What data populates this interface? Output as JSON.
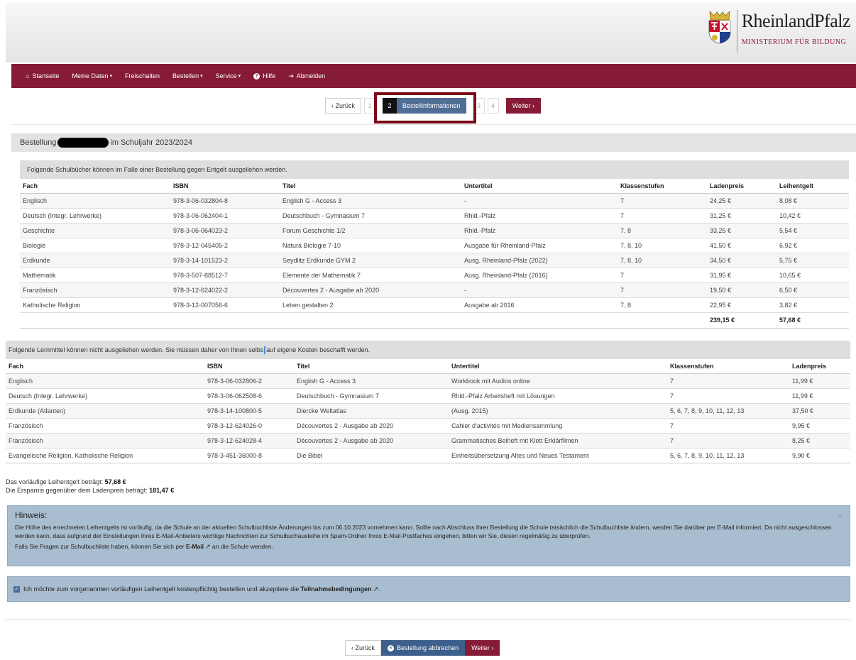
{
  "brand": {
    "name": "RheinlandPfalz",
    "subtitle": "MINISTERIUM FÜR BILDUNG"
  },
  "nav": [
    {
      "label": "Startseite",
      "icon": "home-icon"
    },
    {
      "label": "Meine Daten",
      "icon": "",
      "caret": true
    },
    {
      "label": "Freischalten",
      "icon": ""
    },
    {
      "label": "Bestellen",
      "icon": "",
      "caret": true
    },
    {
      "label": "Service",
      "icon": "",
      "caret": true
    },
    {
      "label": "Hilfe",
      "icon": "question-icon"
    },
    {
      "label": "Abmelden",
      "icon": "logout-icon"
    }
  ],
  "stepper": {
    "back": "‹ Zurück",
    "step1": "1",
    "active_num": "2",
    "active_label": "Bestellinformationen",
    "step3": "3",
    "step4": "4",
    "next": "Weiter ›"
  },
  "order_heading": {
    "prefix": "Bestellung",
    "suffix": "im Schuljahr 2023/2024"
  },
  "loan": {
    "heading": "Folgende Schulbücher können im Falle einer Bestellung gegen Entgelt ausgeliehen werden.",
    "columns": [
      "Fach",
      "ISBN",
      "Titel",
      "Untertitel",
      "Klassenstufen",
      "Ladenpreis",
      "Leihentgelt"
    ],
    "rows": [
      [
        "Englisch",
        "978-3-06-032804-8",
        "English G - Access 3",
        "-",
        "7",
        "24,25 €",
        "8,08 €"
      ],
      [
        "Deutsch (Integr. Lehrwerke)",
        "978-3-06-062404-1",
        "Deutschbuch - Gymnasium 7",
        "Rhld.-Pfalz",
        "7",
        "31,25 €",
        "10,42 €"
      ],
      [
        "Geschichte",
        "978-3-06-064023-2",
        "Forum Geschichte 1/2",
        "Rhld.-Pfalz",
        "7, 8",
        "33,25 €",
        "5,54 €"
      ],
      [
        "Biologie",
        "978-3-12-045405-2",
        "Natura Biologie 7-10",
        "Ausgabe für Rheinland-Pfalz",
        "7, 8, 10",
        "41,50 €",
        "6,92 €"
      ],
      [
        "Erdkunde",
        "978-3-14-101523-2",
        "Seydlitz Erdkunde GYM 2",
        "Ausg. Rheinland-Pfalz (2022)",
        "7, 8, 10",
        "34,50 €",
        "5,75 €"
      ],
      [
        "Mathematik",
        "978-3-507-88512-7",
        "Elemente der Mathematik 7",
        "Ausg. Rheinland-Pfalz (2016)",
        "7",
        "31,95 €",
        "10,65 €"
      ],
      [
        "Französisch",
        "978-3-12-624022-2",
        "Découvertes 2 - Ausgabe ab 2020",
        "-",
        "7",
        "19,50 €",
        "6,50 €"
      ],
      [
        "Katholische Religion",
        "978-3-12-007056-6",
        "Leben gestalten 2",
        "Ausgabe ab 2016",
        "7, 8",
        "22,95 €",
        "3,82 €"
      ]
    ],
    "total_price": "239,15 €",
    "total_fee": "57,68 €"
  },
  "buy": {
    "heading_a": "Folgende Lernmittel können nicht ausgeliehen werden. Sie müssen daher von Ihnen selbs",
    "heading_b": " auf eigene Kosten beschafft werden.",
    "columns": [
      "Fach",
      "ISBN",
      "Titel",
      "Untertitel",
      "Klassenstufen",
      "Ladenpreis"
    ],
    "rows": [
      [
        "Englisch",
        "978-3-06-032806-2",
        "English G - Access 3",
        "Workbook mit Audios online",
        "7",
        "11,99 €"
      ],
      [
        "Deutsch (Integr. Lehrwerke)",
        "978-3-06-062508-6",
        "Deutschbuch - Gymnasium 7",
        "Rhld.-Pfalz Arbeitsheft mit Lösungen",
        "7",
        "11,99 €"
      ],
      [
        "Erdkunde (Atlanten)",
        "978-3-14-100800-5",
        "Diercke Weltatlas",
        "(Ausg. 2015)",
        "5, 6, 7, 8, 9, 10, 11, 12, 13",
        "37,50 €"
      ],
      [
        "Französisch",
        "978-3-12-624026-0",
        "Découvertes 2 - Ausgabe ab 2020",
        "Cahier d'activités mit Mediensammlung",
        "7",
        "9,95 €"
      ],
      [
        "Französisch",
        "978-3-12-624028-4",
        "Découvertes 2 - Ausgabe ab 2020",
        "Grammatisches Beiheft mit Klett Erklärfilmen",
        "7",
        "8,25 €"
      ],
      [
        "Evangelische Religion, Katholische Religion",
        "978-3-451-36000-8",
        "Die Bibel",
        "Einheitsübersetzung Altes und Neues Testament",
        "5, 6, 7, 8, 9, 10, 11, 12, 13",
        "9,90 €"
      ]
    ]
  },
  "summary": {
    "line1_text": "Das vorläufige Leihentgelt beträgt: ",
    "line1_value": "57,68 €",
    "line2_text": "Die Ersparnis gegenüber dem Ladenpreis beträgt: ",
    "line2_value": "181,47 €"
  },
  "alert": {
    "title": "Hinweis:",
    "text1": "Die Höhe des errechneten Leihentgelts ist vorläufig, da die Schule an der aktuellen Schulbuchliste Änderungen bis zum 06.10.2023 vornehmen kann. Sollte nach Abschluss Ihrer Bestellung die Schule tatsächlich die Schulbuchliste ändern, werden Sie darüber per E-Mail informiert. Da nicht ausgeschlossen werden kann, dass aufgrund der Einstellungen Ihres E-Mail-Anbieters wichtige Nachrichten zur Schulbuchausleihe im Spam-Ordner Ihres E-Mail-Postfaches eingehen, bitten wir Sie, diesen regelmäßig zu überprüfen.",
    "text2_a": "Falls Sie Fragen zur Schulbuchliste haben, können Sie sich per ",
    "text2_link": "E-Mail",
    "text2_b": " an die Schule wenden.",
    "close": "×"
  },
  "consent": {
    "text": "Ich möchte zum vorgenannten vorläufigen Leihentgelt kostenpflichtig bestellen und akzeptiere die ",
    "link": "Teilnahmebedingungen",
    "end": " ."
  },
  "footer": {
    "back": "‹ Zurück",
    "cancel": "Bestellung abbrechen",
    "next": "Weiter ›"
  }
}
